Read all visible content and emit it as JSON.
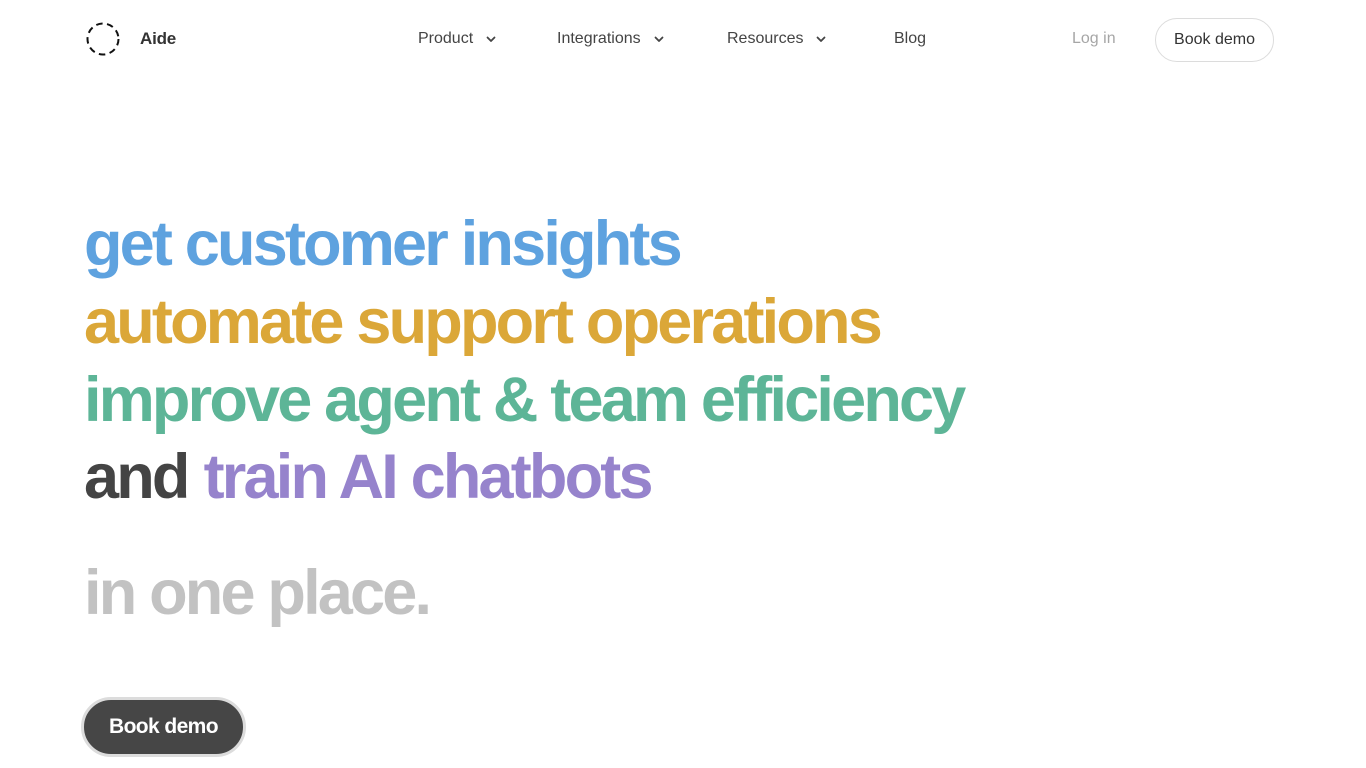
{
  "brand": {
    "name": "Aide",
    "logo_icon": "dashed-circle-icon"
  },
  "nav": {
    "items": [
      {
        "label": "Product",
        "has_dropdown": true
      },
      {
        "label": "Integrations",
        "has_dropdown": true
      },
      {
        "label": "Resources",
        "has_dropdown": true
      },
      {
        "label": "Blog",
        "has_dropdown": false
      }
    ],
    "login_label": "Log in",
    "cta_label": "Book demo"
  },
  "hero": {
    "line1": "get customer insights",
    "line2": "automate support operations",
    "line3": "improve agent & team efficiency",
    "line4_prefix": "and",
    "line4_highlight": "train AI chatbots",
    "tagline": "in one place.",
    "cta_label": "Book demo"
  },
  "colors": {
    "blue": "#5ea2df",
    "gold": "#dba738",
    "green": "#5db597",
    "purple": "#9683cc",
    "dark": "#444444",
    "muted": "#c2c2c2"
  }
}
